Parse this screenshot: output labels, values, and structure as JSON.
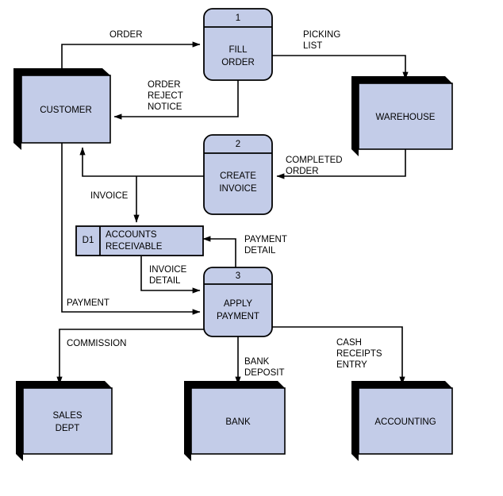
{
  "diagram": {
    "title": "Order and Payment Processing Data Flow Diagram",
    "type": "data-flow-diagram",
    "colors": {
      "fill": "#c3cce8",
      "stroke": "#000000",
      "shadow": "#000000",
      "background": "#ffffff"
    }
  },
  "external_entities": [
    {
      "id": "customer",
      "label": "CUSTOMER",
      "label_lines": [
        "CUSTOMER"
      ]
    },
    {
      "id": "warehouse",
      "label": "WAREHOUSE",
      "label_lines": [
        "WAREHOUSE"
      ]
    },
    {
      "id": "sales_dept",
      "label": "SALES DEPT",
      "label_lines": [
        "SALES",
        "DEPT"
      ]
    },
    {
      "id": "bank",
      "label": "BANK",
      "label_lines": [
        "BANK"
      ]
    },
    {
      "id": "accounting",
      "label": "ACCOUNTING",
      "label_lines": [
        "ACCOUNTING"
      ]
    }
  ],
  "processes": [
    {
      "id": "p1",
      "number": "1",
      "label": "FILL ORDER",
      "label_lines": [
        "FILL",
        "ORDER"
      ]
    },
    {
      "id": "p2",
      "number": "2",
      "label": "CREATE INVOICE",
      "label_lines": [
        "CREATE",
        "INVOICE"
      ]
    },
    {
      "id": "p3",
      "number": "3",
      "label": "APPLY PAYMENT",
      "label_lines": [
        "APPLY",
        "PAYMENT"
      ]
    }
  ],
  "data_stores": [
    {
      "id": "d1",
      "code": "D1",
      "label": "ACCOUNTS RECEIVABLE",
      "label_lines": [
        "ACCOUNTS",
        "RECEIVABLE"
      ]
    }
  ],
  "data_flows": [
    {
      "id": "order",
      "label": "ORDER",
      "label_lines": [
        "ORDER"
      ],
      "from": "customer",
      "to": "p1"
    },
    {
      "id": "picking_list",
      "label": "PICKING LIST",
      "label_lines": [
        "PICKING",
        "LIST"
      ],
      "from": "p1",
      "to": "warehouse"
    },
    {
      "id": "order_reject_notice",
      "label": "ORDER REJECT NOTICE",
      "label_lines": [
        "ORDER",
        "REJECT",
        "NOTICE"
      ],
      "from": "p1",
      "to": "customer"
    },
    {
      "id": "completed_order",
      "label": "COMPLETED ORDER",
      "label_lines": [
        "COMPLETED",
        "ORDER"
      ],
      "from": "warehouse",
      "to": "p2"
    },
    {
      "id": "invoice",
      "label": "INVOICE",
      "label_lines": [
        "INVOICE"
      ],
      "from": "p2",
      "to": "customer"
    },
    {
      "id": "payment_detail",
      "label": "PAYMENT DETAIL",
      "label_lines": [
        "PAYMENT",
        "DETAIL"
      ],
      "from": "p3",
      "to": "d1"
    },
    {
      "id": "invoice_detail",
      "label": "INVOICE DETAIL",
      "label_lines": [
        "INVOICE",
        "DETAIL"
      ],
      "from": "d1",
      "to": "p3"
    },
    {
      "id": "payment",
      "label": "PAYMENT",
      "label_lines": [
        "PAYMENT"
      ],
      "from": "customer",
      "to": "p3"
    },
    {
      "id": "commission",
      "label": "COMMISSION",
      "label_lines": [
        "COMMISSION"
      ],
      "from": "p3",
      "to": "sales_dept"
    },
    {
      "id": "bank_deposit",
      "label": "BANK DEPOSIT",
      "label_lines": [
        "BANK",
        "DEPOSIT"
      ],
      "from": "p3",
      "to": "bank"
    },
    {
      "id": "cash_receipts_entry",
      "label": "CASH RECEIPTS ENTRY",
      "label_lines": [
        "CASH",
        "RECEIPTS",
        "ENTRY"
      ],
      "from": "p3",
      "to": "accounting"
    }
  ],
  "labels": {
    "order": "ORDER",
    "picking_1": "PICKING",
    "picking_2": "LIST",
    "reject_1": "ORDER",
    "reject_2": "REJECT",
    "reject_3": "NOTICE",
    "completed_1": "COMPLETED",
    "completed_2": "ORDER",
    "invoice": "INVOICE",
    "payment_detail_1": "PAYMENT",
    "payment_detail_2": "DETAIL",
    "invoice_detail_1": "INVOICE",
    "invoice_detail_2": "DETAIL",
    "payment": "PAYMENT",
    "commission": "COMMISSION",
    "bank_deposit_1": "BANK",
    "bank_deposit_2": "DEPOSIT",
    "cash_1": "CASH",
    "cash_2": "RECEIPTS",
    "cash_3": "ENTRY",
    "customer": "CUSTOMER",
    "warehouse": "WAREHOUSE",
    "sales_1": "SALES",
    "sales_2": "DEPT",
    "bank": "BANK",
    "accounting": "ACCOUNTING",
    "p1_num": "1",
    "p1_l1": "FILL",
    "p1_l2": "ORDER",
    "p2_num": "2",
    "p2_l1": "CREATE",
    "p2_l2": "INVOICE",
    "p3_num": "3",
    "p3_l1": "APPLY",
    "p3_l2": "PAYMENT",
    "d1_code": "D1",
    "d1_l1": "ACCOUNTS",
    "d1_l2": "RECEIVABLE"
  }
}
